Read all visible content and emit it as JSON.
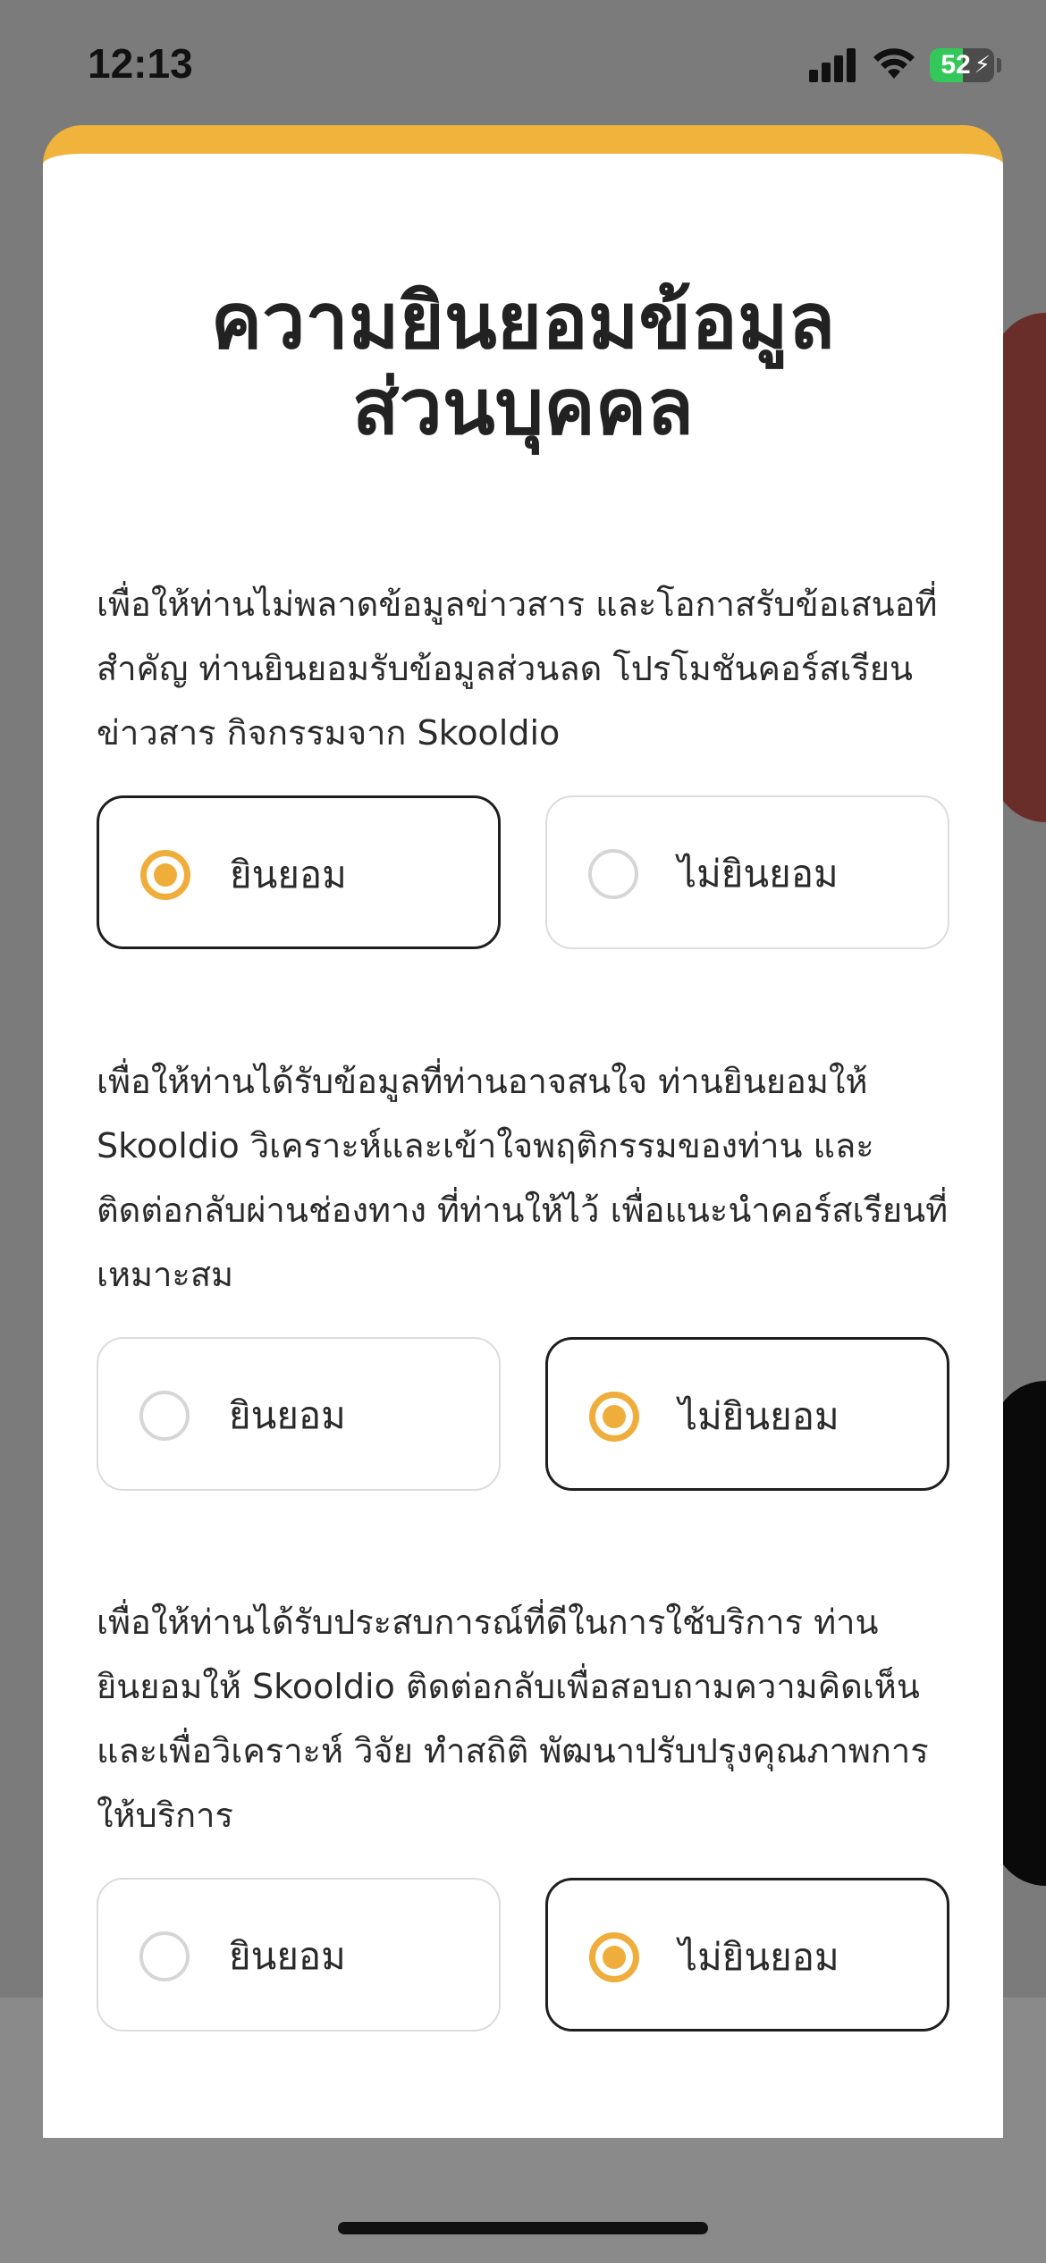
{
  "status_bar": {
    "time": "12:13",
    "battery_level": "52",
    "signal_icon": "cellular-signal-icon",
    "wifi_icon": "wifi-icon",
    "battery_icon": "battery-charging-icon",
    "battery_color": "#34c759"
  },
  "consent_sheet": {
    "title_line1": "ความยินยอมข้อมูล",
    "title_line2": "ส่วนบุคคล",
    "accent_color": "#f0b33c",
    "questions": [
      {
        "text_lines": [
          "เพื่อให้ท่านไม่พลาดข้อมูลข่าวสาร และโอกาสรับข้อเสนอที่",
          "สำคัญ ท่านยินยอมรับข้อมูลส่วนลด โปรโมชันคอร์สเรียน",
          "ข่าวสาร กิจกรรมจาก Skooldio"
        ],
        "agree_label": "ยินยอม",
        "disagree_label": "ไม่ยินยอม",
        "selected": "agree"
      },
      {
        "text_lines": [
          "เพื่อให้ท่านได้รับข้อมูลที่ท่านอาจสนใจ ท่านยินยอมให้",
          "Skooldio วิเคราะห์และเข้าใจพฤติกรรมของท่าน และ",
          "ติดต่อกลับผ่านช่องทาง ที่ท่านให้ไว้ เพื่อแนะนำคอร์สเรียนที่",
          "เหมาะสม"
        ],
        "agree_label": "ยินยอม",
        "disagree_label": "ไม่ยินยอม",
        "selected": "disagree"
      },
      {
        "text_lines": [
          "เพื่อให้ท่านได้รับประสบการณ์ที่ดีในการใช้บริการ ท่าน",
          "ยินยอมให้ Skooldio ติดต่อกลับเพื่อสอบถามความคิดเห็น",
          "และเพื่อวิเคราะห์ วิจัย ทำสถิติ พัฒนาปรับปรุงคุณภาพการ",
          "ให้บริการ"
        ],
        "agree_label": "ยินยอม",
        "disagree_label": "ไม่ยินยอม",
        "selected": "disagree"
      }
    ],
    "radio_selected_color": "#efae3c"
  }
}
